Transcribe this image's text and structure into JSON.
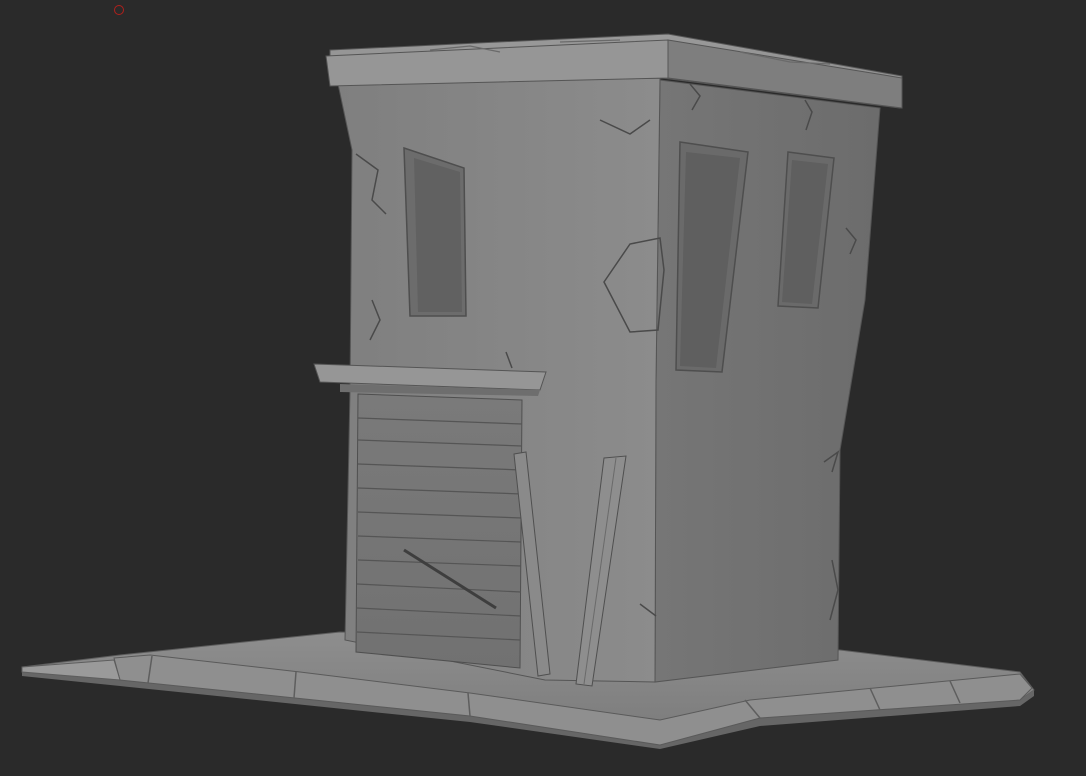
{
  "viewport": {
    "background": "#2a2a2a",
    "mode": "3d-sculpt-view"
  },
  "brush_cursor": {
    "icon": "brush-cursor-ring-icon",
    "color": "#b0201c"
  },
  "model": {
    "subject": "ruined-stone-building-sculpt",
    "material_color": "#8a8a8a"
  }
}
